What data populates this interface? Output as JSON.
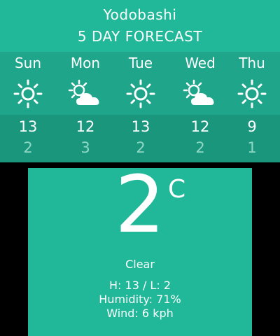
{
  "header": {
    "city": "Yodobashi",
    "subtitle": "5 DAY FORECAST"
  },
  "forecast": [
    {
      "day": "Sun",
      "icon": "sun-icon",
      "high": "13",
      "low": "2"
    },
    {
      "day": "Mon",
      "icon": "partly-cloudy-icon",
      "high": "12",
      "low": "3"
    },
    {
      "day": "Tue",
      "icon": "sun-icon",
      "high": "13",
      "low": "2"
    },
    {
      "day": "Wed",
      "icon": "partly-cloudy-icon",
      "high": "12",
      "low": "2"
    },
    {
      "day": "Thu",
      "icon": "sun-icon",
      "high": "9",
      "low": "1"
    }
  ],
  "current": {
    "temperature": "2",
    "unit": "C",
    "condition": "Clear",
    "hilo_label": "H: 13 / L: 2",
    "humidity": "Humidity: 71%",
    "wind": "Wind: 6 kph"
  },
  "colors": {
    "header_bg": "#20b898",
    "forecast_top_bg": "#1ea58a",
    "forecast_bottom_bg": "#1a967d",
    "low_temp": "#8fd8c6",
    "background": "#000000"
  }
}
